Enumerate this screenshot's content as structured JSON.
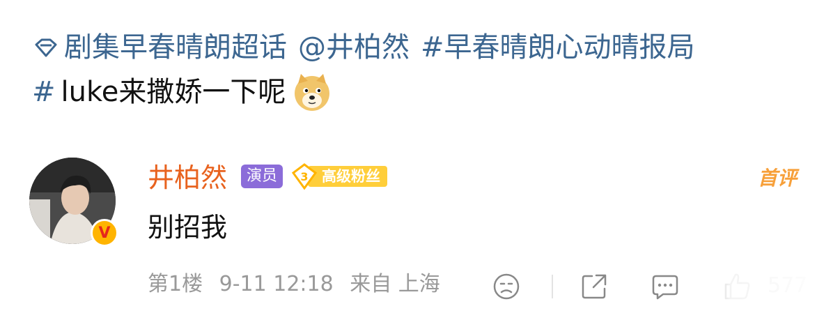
{
  "post": {
    "super_topic": "剧集早春晴朗超话",
    "mention": "@井柏然",
    "hashtag1": "#早春晴朗心动晴报局",
    "hashtag2_symbol": "#",
    "hashtag2_text": "luke来撒娇一下呢",
    "emoji": "doge-emoji"
  },
  "comment": {
    "username": "井柏然",
    "role_tag": "演员",
    "fan_level": "3",
    "fan_label": "高级粉丝",
    "first_badge": "首评",
    "text": "别招我",
    "floor": "第1楼",
    "time": "9-11 12:18",
    "source": "来自 上海",
    "like_count": "577",
    "verified_mark": "V"
  },
  "colors": {
    "link": "#3c6690",
    "username": "#e8621e",
    "role_tag_bg": "#8b6cd9",
    "fan_badge_bg": "#ffce3a",
    "first_badge": "#f7a03a",
    "meta": "#999999"
  },
  "icons": [
    "gem-icon",
    "doge-icon",
    "verified-badge",
    "dislike-icon",
    "share-icon",
    "comment-icon",
    "like-icon"
  ]
}
